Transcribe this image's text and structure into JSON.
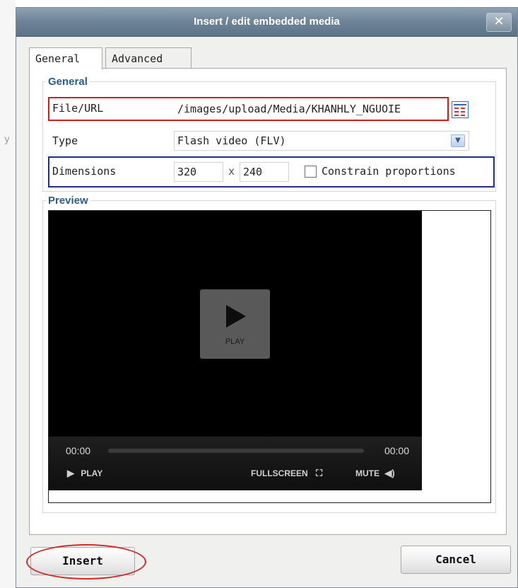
{
  "dialog": {
    "title": "Insert / edit embedded media",
    "close_label": "✕"
  },
  "tabs": [
    {
      "label": "General"
    },
    {
      "label": "Advanced"
    }
  ],
  "general": {
    "legend": "General",
    "file_label": "File/URL",
    "file_value": "/images/upload/Media/KHANHLY_NGUOIE",
    "type_label": "Type",
    "type_value": "Flash video (FLV)",
    "dimensions_label": "Dimensions",
    "width": "320",
    "x_sep": "x",
    "height": "240",
    "constrain_label": "Constrain proportions",
    "constrain_checked": false
  },
  "preview": {
    "legend": "Preview",
    "play_label": "PLAY",
    "time_current": "00:00",
    "time_total": "00:00",
    "ctrl_play": "PLAY",
    "ctrl_fullscreen": "FULLSCREEN",
    "ctrl_mute": "MUTE"
  },
  "buttons": {
    "insert": "Insert",
    "cancel": "Cancel"
  },
  "colors": {
    "highlight_red": "#cc1f1f",
    "highlight_blue": "#1f2f8a",
    "legend_blue": "#2b5b8a"
  }
}
